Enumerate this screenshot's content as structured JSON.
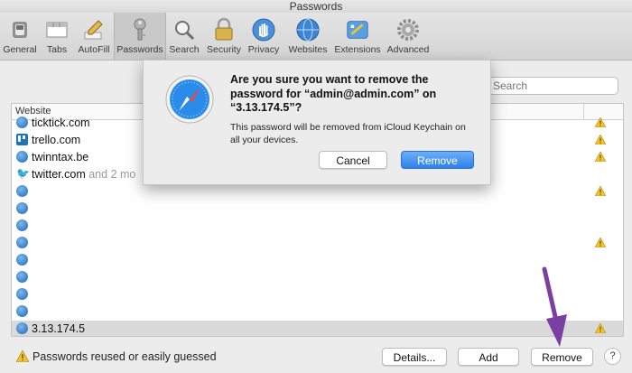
{
  "window": {
    "title": "Passwords"
  },
  "toolbar": {
    "items": [
      {
        "label": "General",
        "icon": "switch-icon"
      },
      {
        "label": "Tabs",
        "icon": "tabs-icon"
      },
      {
        "label": "AutoFill",
        "icon": "pencil-icon"
      },
      {
        "label": "Passwords",
        "icon": "key-icon",
        "selected": true
      },
      {
        "label": "Search",
        "icon": "magnifier-icon"
      },
      {
        "label": "Security",
        "icon": "lock-icon"
      },
      {
        "label": "Privacy",
        "icon": "hand-icon"
      },
      {
        "label": "Websites",
        "icon": "globe-icon"
      },
      {
        "label": "Extensions",
        "icon": "puzzle-icon"
      },
      {
        "label": "Advanced",
        "icon": "gear-icon"
      }
    ]
  },
  "search": {
    "placeholder": "Search"
  },
  "table": {
    "header": "Website",
    "rows": [
      {
        "site": "ticktick.com",
        "icon": "globe-icon",
        "warning": true
      },
      {
        "site": "trello.com",
        "icon": "trello-icon",
        "warning": true
      },
      {
        "site": "twinntax.be",
        "icon": "globe-icon",
        "warning": true
      },
      {
        "site": "twitter.com",
        "more": "and 2 mo",
        "icon": "twitter-icon",
        "warning": false
      },
      {
        "site": "",
        "icon": "globe-icon",
        "warning": true
      },
      {
        "site": "",
        "icon": "globe-icon",
        "warning": false
      },
      {
        "site": "",
        "icon": "globe-icon",
        "warning": false
      },
      {
        "site": "",
        "icon": "globe-icon",
        "warning": true
      },
      {
        "site": "",
        "icon": "globe-icon",
        "warning": false
      },
      {
        "site": "",
        "icon": "globe-icon",
        "warning": false
      },
      {
        "site": "",
        "icon": "globe-icon",
        "warning": false
      },
      {
        "site": "",
        "icon": "globe-icon",
        "warning": false
      },
      {
        "site": "3.13.174.5",
        "icon": "globe-icon",
        "warning": true,
        "selected": true
      }
    ]
  },
  "dialog": {
    "title": "Are you sure you want to remove the password for “admin@admin.com” on “3.13.174.5”?",
    "message": "This password will be removed from iCloud Keychain on all your devices.",
    "cancel_label": "Cancel",
    "remove_label": "Remove"
  },
  "bottom": {
    "warning_text": "Passwords reused or easily guessed",
    "details_label": "Details...",
    "add_label": "Add",
    "remove_label": "Remove",
    "help_label": "?"
  },
  "colors": {
    "accent": "#2f80ee",
    "annotation_arrow": "#7b3fa3",
    "warning": "#f2c230"
  }
}
